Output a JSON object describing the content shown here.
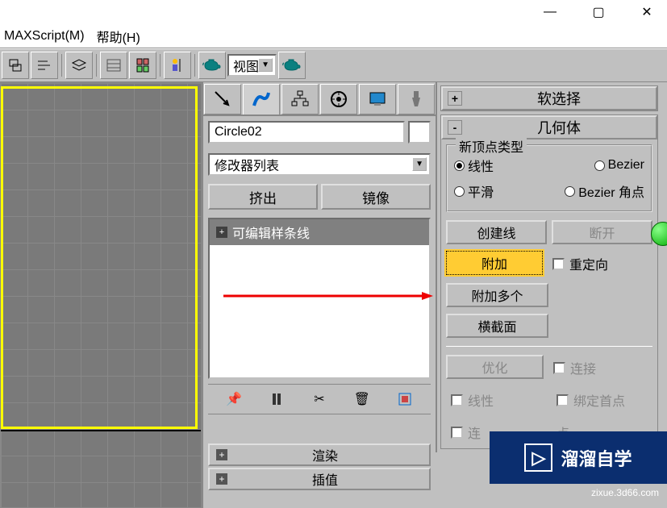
{
  "menubar": {
    "maxscript": "MAXScript(M)",
    "help": "帮助(H)"
  },
  "toolbar": {
    "view_select": "视图"
  },
  "panel": {
    "object_name": "Circle02",
    "modifier_list": "修改器列表",
    "btn_extrude": "挤出",
    "btn_mirror": "镜像",
    "stack_item": "可编辑样条线",
    "rollup_render": "渲染",
    "rollup_interp": "插值"
  },
  "panel_b": {
    "rollup_soft": "软选择",
    "rollup_geom": "几何体",
    "group_vertex": "新顶点类型",
    "radio_linear": "线性",
    "radio_bezier": "Bezier",
    "radio_smooth": "平滑",
    "radio_bcorner": "Bezier 角点",
    "btn_create_line": "创建线",
    "btn_break": "断开",
    "btn_attach": "附加",
    "chk_reorient": "重定向",
    "btn_attach_multi": "附加多个",
    "btn_cross": "横截面",
    "btn_optimize": "优化",
    "chk_connect": "连接",
    "chk_linear": "线性",
    "chk_bind_first": "绑定首点",
    "chk_conn2": "连",
    "chk_pt": "点"
  },
  "watermark": {
    "text": "溜溜自学",
    "url": "zixue.3d66.com"
  }
}
